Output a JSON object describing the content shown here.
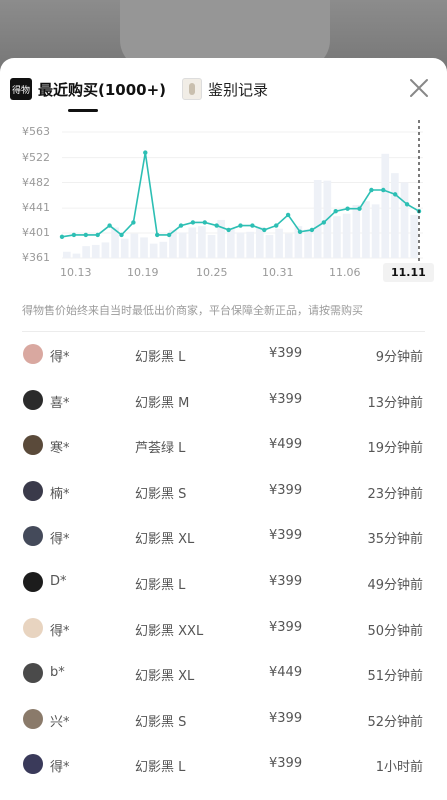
{
  "tabs": [
    {
      "label": "最近购买(1000+)",
      "logo_text": "得物",
      "active": true
    },
    {
      "label": "鉴别记录",
      "active": false
    }
  ],
  "chart_data": {
    "type": "bar+line",
    "y_ticks": [
      "¥563",
      "¥522",
      "¥482",
      "¥441",
      "¥401",
      "¥361"
    ],
    "y_values": [
      563,
      522,
      482,
      441,
      401,
      361
    ],
    "ylim": [
      361,
      563
    ],
    "x_ticks": [
      "10.13",
      "10.19",
      "10.25",
      "10.31",
      "11.06",
      "11.11"
    ],
    "selected_x": "11.11",
    "line_values": [
      395,
      398,
      398,
      398,
      413,
      398,
      418,
      530,
      398,
      398,
      413,
      418,
      418,
      413,
      406,
      413,
      413,
      406,
      413,
      430,
      403,
      406,
      418,
      436,
      440,
      440,
      470,
      470,
      463,
      447,
      436
    ],
    "bar_values": [
      371,
      368,
      380,
      382,
      386,
      410,
      392,
      400,
      394,
      384,
      387,
      406,
      402,
      410,
      412,
      398,
      422,
      409,
      402,
      403,
      411,
      398,
      408,
      400,
      412,
      407,
      486,
      485,
      428,
      432,
      446,
      452,
      447,
      528,
      497,
      482,
      430
    ]
  },
  "disclaimer": "得物售价始终来自当时最低出价商家，平台保障全新正品，请按需购买",
  "purchases": [
    {
      "name": "得*",
      "variant": "幻影黑 L",
      "price": "¥399",
      "time": "9分钟前",
      "avatar_color": "#d9a8a0"
    },
    {
      "name": "喜*",
      "variant": "幻影黑 M",
      "price": "¥399",
      "time": "13分钟前",
      "avatar_color": "#2b2b2b"
    },
    {
      "name": "寒*",
      "variant": "芦荟绿 L",
      "price": "¥499",
      "time": "19分钟前",
      "avatar_color": "#5a4a3a"
    },
    {
      "name": "楠*",
      "variant": "幻影黑 S",
      "price": "¥399",
      "time": "23分钟前",
      "avatar_color": "#3a3a4a"
    },
    {
      "name": "得*",
      "variant": "幻影黑 XL",
      "price": "¥399",
      "time": "35分钟前",
      "avatar_color": "#444a5a"
    },
    {
      "name": "D*",
      "variant": "幻影黑 L",
      "price": "¥399",
      "time": "49分钟前",
      "avatar_color": "#1c1c1c"
    },
    {
      "name": "得*",
      "variant": "幻影黑 XXL",
      "price": "¥399",
      "time": "50分钟前",
      "avatar_color": "#e8d4c0"
    },
    {
      "name": "b*",
      "variant": "幻影黑 XL",
      "price": "¥449",
      "time": "51分钟前",
      "avatar_color": "#4a4a4a"
    },
    {
      "name": "兴*",
      "variant": "幻影黑 S",
      "price": "¥399",
      "time": "52分钟前",
      "avatar_color": "#8a7a6a"
    },
    {
      "name": "得*",
      "variant": "幻影黑 L",
      "price": "¥399",
      "time": "1小时前",
      "avatar_color": "#3a3a5a"
    }
  ],
  "colors": {
    "line": "#2dbfb4",
    "bar": "#eef1f7",
    "text_muted": "#9a9a9a"
  }
}
